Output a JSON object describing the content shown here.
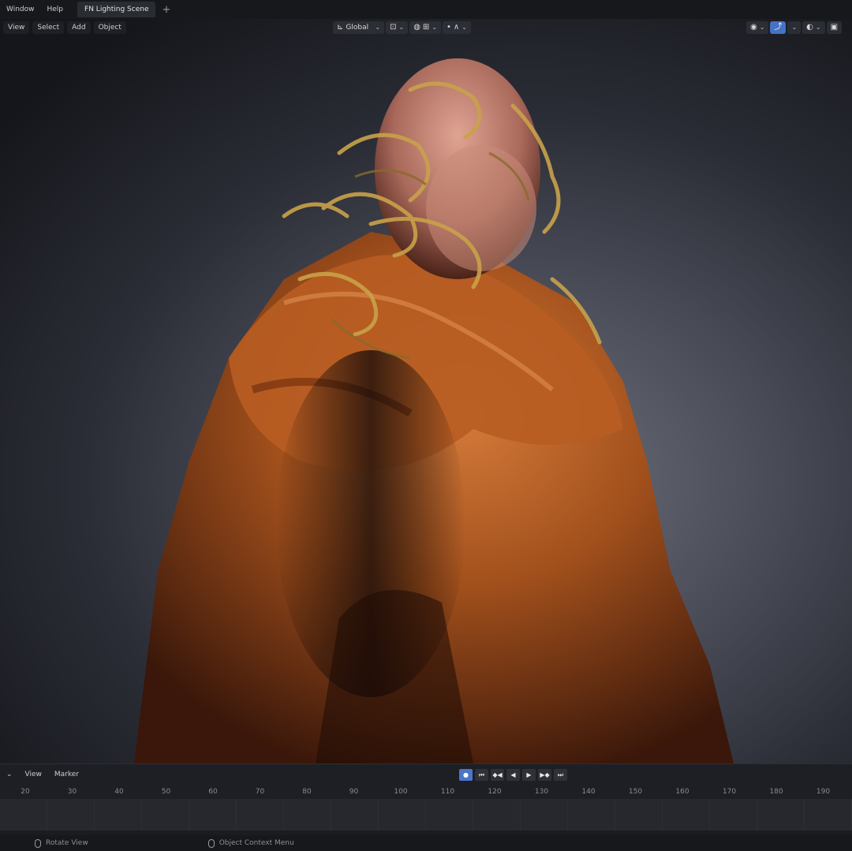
{
  "menu": {
    "items": [
      "Window",
      "Help"
    ],
    "active_tab": "FN Lighting Scene",
    "add_tab_glyph": "+"
  },
  "viewport_header": {
    "left_items": [
      "View",
      "Select",
      "Add",
      "Object"
    ],
    "transform_orientation": "Global",
    "pivot_icon": "pivot-point-icon",
    "snap_icon": "snap-icon",
    "proportional_icon": "proportional-edit-icon",
    "right_icons": [
      "visibility-icon",
      "gizmo-icon",
      "overlay-icon",
      "shading-icon"
    ]
  },
  "timeline": {
    "menu_items": [
      "View",
      "Marker"
    ],
    "transport_buttons": [
      "record",
      "jump-start",
      "prev-keyframe",
      "play-reverse",
      "play",
      "next-keyframe",
      "jump-end"
    ],
    "frame_ticks": [
      "20",
      "30",
      "40",
      "50",
      "60",
      "70",
      "80",
      "90",
      "100",
      "110",
      "120",
      "130",
      "140",
      "150",
      "160",
      "170",
      "180",
      "190"
    ]
  },
  "statusbar": {
    "left_hint": "Rotate View",
    "middle_hint": "Object Context Menu"
  },
  "colors": {
    "accent": "#4672c4",
    "figure_orange": "#b55a1e",
    "figure_gold": "#c9a24a",
    "background": "#1b1c21"
  }
}
